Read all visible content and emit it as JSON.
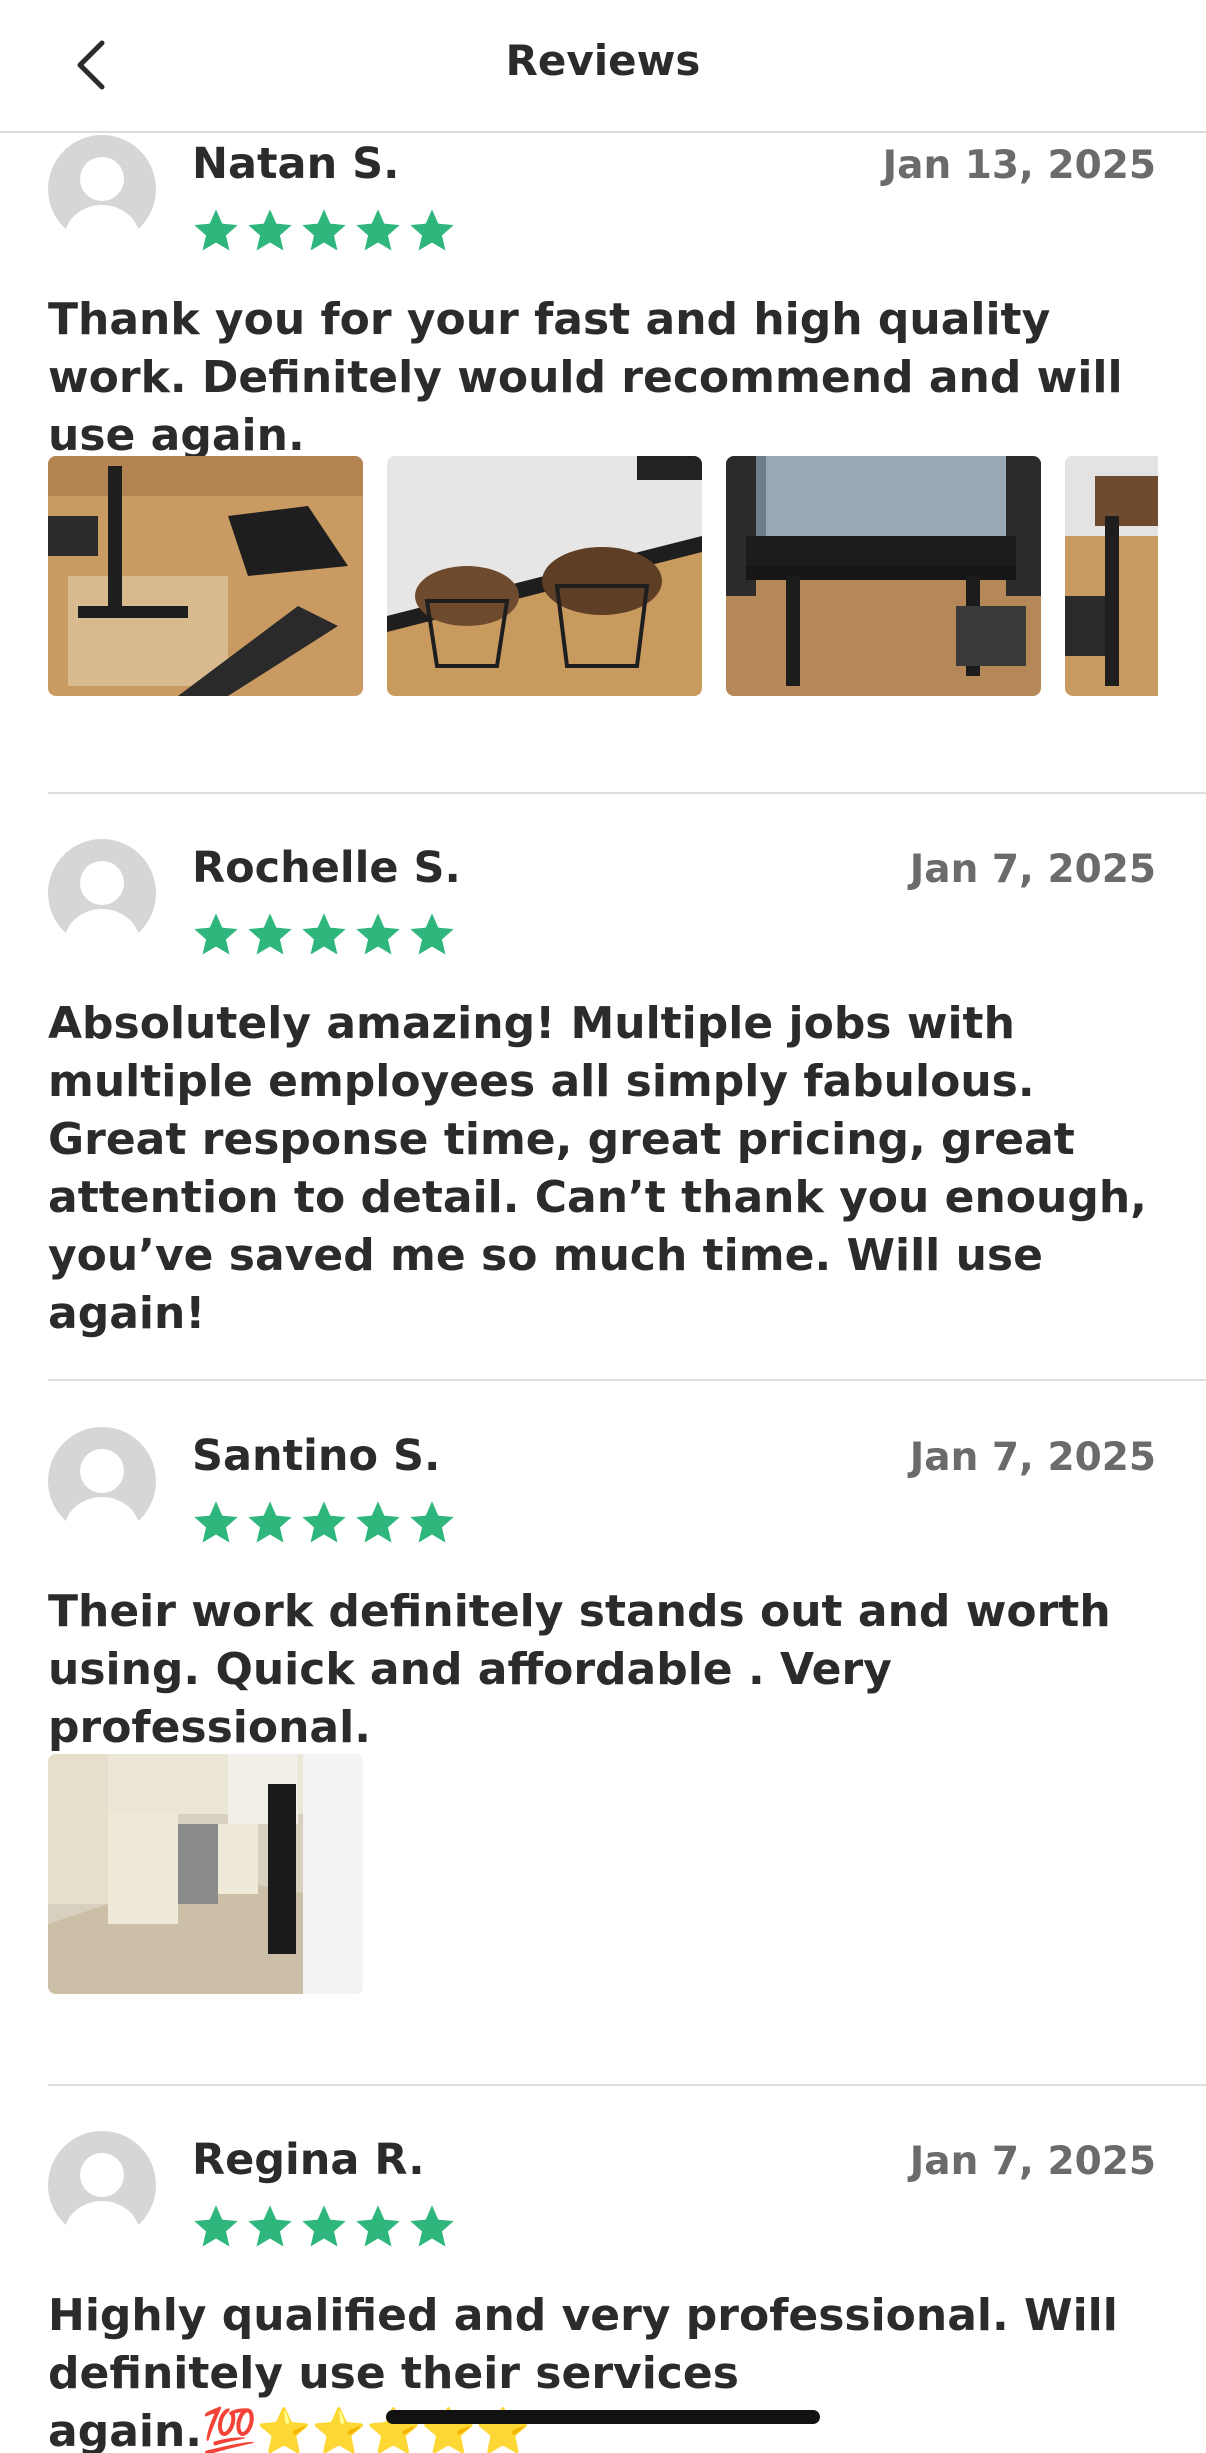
{
  "header": {
    "title": "Reviews",
    "back_icon": "chevron-left-icon"
  },
  "colors": {
    "star": "#2eb67d",
    "date": "#6b6b6b",
    "text": "#2b2b2b",
    "divider": "#dedede"
  },
  "reviews": [
    {
      "name": "Natan S.",
      "date": "Jan 13, 2025",
      "rating": 5,
      "text": "Thank you for your fast and high quality work. Definitely would recommend and will use again.",
      "photos": [
        "desk-assembly-photo",
        "side-tables-photo",
        "standing-desk-photo",
        "desk-partial-photo"
      ]
    },
    {
      "name": "Rochelle S.",
      "date": "Jan 7, 2025",
      "rating": 5,
      "text": "Absolutely amazing! Multiple jobs with multiple employees all simply fabulous. Great response time, great pricing, great attention to detail. Can’t thank you enough, you’ve saved me so much time. Will use again!",
      "photos": []
    },
    {
      "name": "Santino S.",
      "date": "Jan 7, 2025",
      "rating": 5,
      "text": "Their work definitely stands out and worth using. Quick and affordable . Very professional.",
      "photos": [
        "kitchen-photo"
      ]
    },
    {
      "name": "Regina R.",
      "date": "Jan 7, 2025",
      "rating": 5,
      "text": "Highly qualified and very professional. Will definitely use their services again.💯⭐⭐⭐⭐⭐",
      "photos": []
    }
  ]
}
